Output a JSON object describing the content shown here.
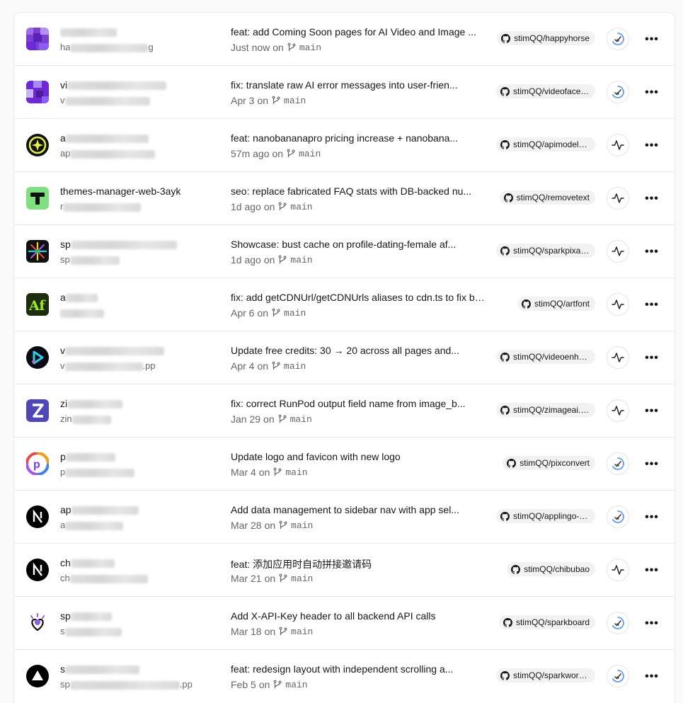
{
  "projects": [
    {
      "name_visible": "",
      "url_visible": "ha",
      "url_tail": "g",
      "commit": "feat: add Coming Soon pages for AI Video and Image ...",
      "time": "Just now",
      "branch": "main",
      "repo": "stimQQ/happyhorse",
      "status": "ready-icon",
      "avatar": "pixel-purple"
    },
    {
      "name_visible": "vi",
      "url_visible": "v",
      "url_tail": "",
      "commit": "fix: translate raw AI error messages into user-frien...",
      "time": "Apr 3",
      "branch": "main",
      "repo": "stimQQ/videofacesw...",
      "status": "ready-icon",
      "avatar": "pixel-purple-2"
    },
    {
      "name_visible": "a",
      "url_visible": "ap",
      "url_tail": "",
      "commit": "feat: nanobananapro pricing increase + nanobana...",
      "time": "57m ago",
      "branch": "main",
      "repo": "stimQQ/apimodels-ne...",
      "status": "activity-icon",
      "avatar": "star-yellow"
    },
    {
      "name_visible": "themes-manager-web-3ayk",
      "url_visible": "r",
      "url_tail": "",
      "commit": "seo: replace fabricated FAQ stats with DB-backed nu...",
      "time": "1d ago",
      "branch": "main",
      "repo": "stimQQ/removetext",
      "status": "activity-icon",
      "avatar": "t-green"
    },
    {
      "name_visible": "sp",
      "url_visible": "sp",
      "url_tail": "",
      "commit": "Showcase: bust cache on profile-dating-female af...",
      "time": "1d ago",
      "branch": "main",
      "repo": "stimQQ/sparkpixai-na...",
      "status": "activity-icon",
      "avatar": "spark-black"
    },
    {
      "name_visible": "a",
      "url_visible": "",
      "url_tail": "",
      "commit": "fix: add getCDNUrl/getCDNUrls aliases to cdn.ts to fix bu...",
      "time": "Apr 6",
      "branch": "main",
      "repo": "stimQQ/artfont",
      "status": "activity-icon",
      "avatar": "af-green"
    },
    {
      "name_visible": "v",
      "url_visible": "v",
      "url_tail": ".pp",
      "commit": "Update free credits: 30 → 20 across all pages and...",
      "time": "Apr 4",
      "branch": "main",
      "repo": "stimQQ/videoenhanc...",
      "status": "activity-icon",
      "avatar": "play-cyan"
    },
    {
      "name_visible": "zi",
      "url_visible": "zin",
      "url_tail": "",
      "commit": "fix: correct RunPod output field name from image_b...",
      "time": "Jan 29",
      "branch": "main",
      "repo": "stimQQ/zimageai.art",
      "status": "activity-icon",
      "avatar": "z-indigo"
    },
    {
      "name_visible": "p",
      "url_visible": "p",
      "url_tail": "",
      "commit": "Update logo and favicon with new logo",
      "time": "Mar 4",
      "branch": "main",
      "repo": "stimQQ/pixconvert",
      "status": "ready-icon",
      "avatar": "p-rainbow"
    },
    {
      "name_visible": "ap",
      "url_visible": "a",
      "url_tail": "",
      "commit": "Add data management to sidebar nav with app sel...",
      "time": "Mar 28",
      "branch": "main",
      "repo": "stimQQ/applingo-nex...",
      "status": "ready-icon",
      "avatar": "n-black"
    },
    {
      "name_visible": "ch",
      "url_visible": "ch",
      "url_tail": "",
      "commit": "feat: 添加应用时自动拼接邀请码",
      "time": "Mar 21",
      "branch": "main",
      "repo": "stimQQ/chibubao",
      "status": "activity-icon",
      "avatar": "n-black-2"
    },
    {
      "name_visible": "sp",
      "url_visible": "s",
      "url_tail": "",
      "commit": "Add X-API-Key header to all backend API calls",
      "time": "Mar 18",
      "branch": "main",
      "repo": "stimQQ/sparkboard",
      "status": "ready-icon",
      "avatar": "heart-purple"
    },
    {
      "name_visible": "s",
      "url_visible": "sp",
      "url_tail": ".pp",
      "commit": "feat: redesign layout with independent scrolling a...",
      "time": "Feb 5",
      "branch": "main",
      "repo": "stimQQ/sparkwords-...",
      "status": "ready-icon",
      "avatar": "triangle-black"
    }
  ],
  "labels": {
    "on": "on",
    "more": "•••"
  },
  "colors": {
    "accent_blue": "#3b82f6",
    "border": "#ebebeb",
    "muted": "#666666"
  }
}
